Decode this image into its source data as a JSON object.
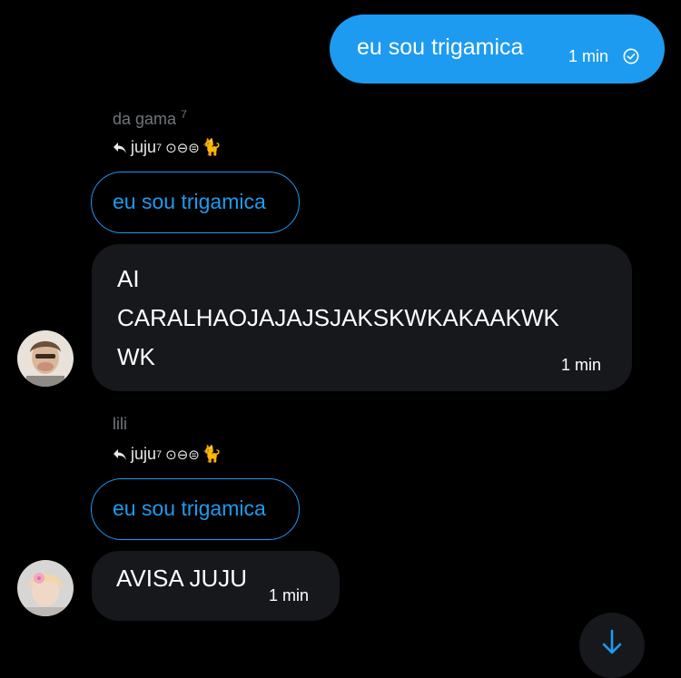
{
  "outgoing": {
    "text": "eu sou trigamica",
    "time": "1 min",
    "status_icon": "sent-check-icon"
  },
  "messages": [
    {
      "sender": "da gama",
      "sender_sup": "7",
      "reply_to": "juju",
      "reply_sup": "7",
      "reply_suffix": "⊙⊖⊜",
      "quote": "eu sou trigamica",
      "text_lines": [
        "AI",
        "CARALHAOJAJAJSJAKSKWKAKAAKWK",
        "WK"
      ],
      "time": "1 min"
    },
    {
      "sender": "lili",
      "reply_to": "juju",
      "reply_sup": "7",
      "reply_suffix": "⊙⊖⊜",
      "quote": "eu sou trigamica",
      "text": "AVISA JUJU",
      "time": "1 min"
    }
  ],
  "colors": {
    "accent": "#1d9bf0",
    "bubble_in": "#16181c",
    "muted": "#71767b"
  }
}
